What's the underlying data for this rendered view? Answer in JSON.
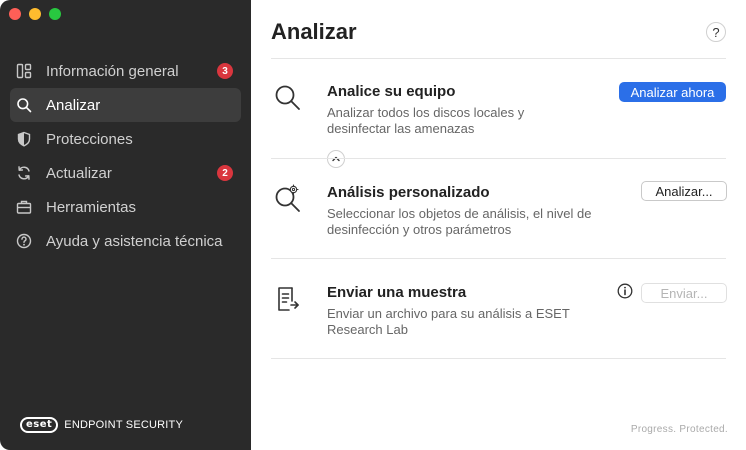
{
  "window": {
    "title": ""
  },
  "sidebar": {
    "items": [
      {
        "label": "Información general",
        "icon": "dashboard-icon",
        "badge": "3"
      },
      {
        "label": "Analizar",
        "icon": "search-icon",
        "active": true
      },
      {
        "label": "Protecciones",
        "icon": "shield-icon"
      },
      {
        "label": "Actualizar",
        "icon": "refresh-icon",
        "badge": "2"
      },
      {
        "label": "Herramientas",
        "icon": "briefcase-icon"
      },
      {
        "label": "Ayuda y asistencia técnica",
        "icon": "help-circle-icon"
      }
    ],
    "brand": {
      "logo_text": "eset",
      "product": "ENDPOINT SECURITY"
    }
  },
  "main": {
    "title": "Analizar",
    "help_label": "?",
    "cards": [
      {
        "title": "Analice su equipo",
        "description": "Analizar todos los discos locales y desinfectar las amenazas",
        "button": "Analizar ahora",
        "icon": "magnifier-icon"
      },
      {
        "title": "Análisis personalizado",
        "description": "Seleccionar los objetos de análisis, el nivel de desinfección y otros parámetros",
        "button": "Analizar...",
        "icon": "custom-scan-icon"
      },
      {
        "title": "Enviar una muestra",
        "description": "Enviar un archivo para su análisis a ESET Research Lab",
        "button": "Enviar...",
        "icon": "document-send-icon"
      }
    ],
    "tagline": "Progress. Protected."
  },
  "colors": {
    "sidebar_bg": "#2a2a2a",
    "sidebar_active": "#3d3d3d",
    "badge": "#d9363e",
    "primary": "#2b6fe8"
  }
}
